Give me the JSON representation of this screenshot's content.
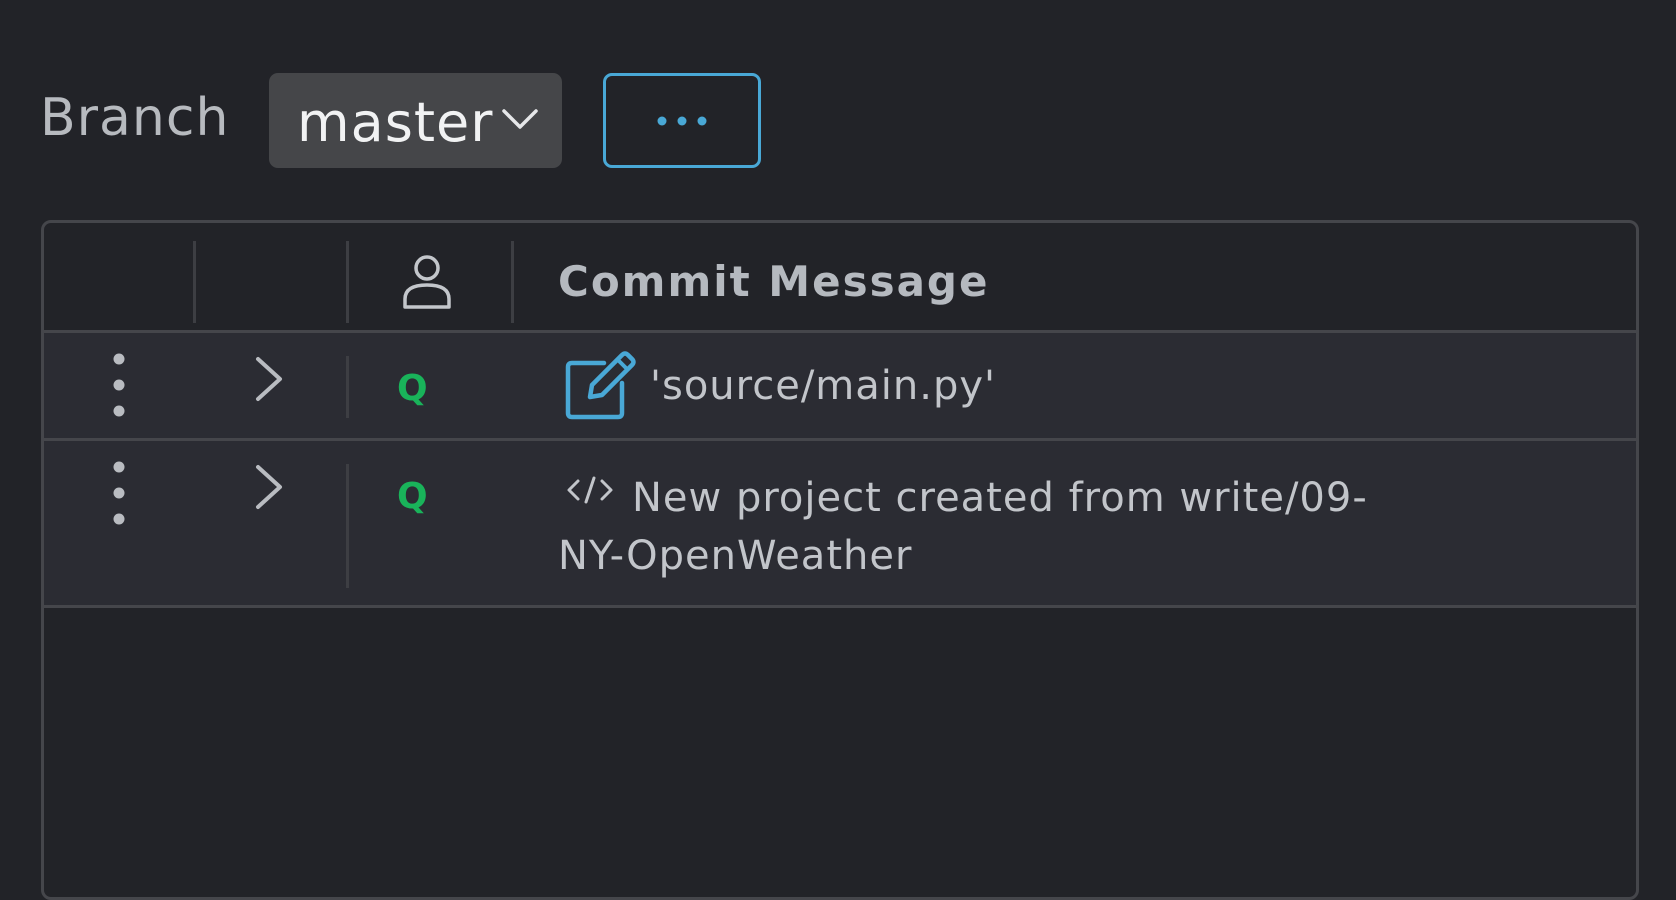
{
  "toolbar": {
    "branch_label": "Branch",
    "branch_value": "master",
    "branch_icon": "chevron-down-icon",
    "more_icon": "ellipsis-icon"
  },
  "grid": {
    "header": {
      "author_icon": "person-icon",
      "commit_message_label": "Commit Message"
    },
    "rows": [
      {
        "author": "Q",
        "type_icon": "edit-icon",
        "message": "'source/main.py'"
      },
      {
        "author": "Q",
        "type_icon": "code-icon",
        "message": "New project created from write/09-NY-OpenWeather"
      }
    ]
  },
  "colors": {
    "background": "#222328",
    "row_background": "#2b2c33",
    "accent": "#49a8d6",
    "author_green": "#19b35a"
  }
}
